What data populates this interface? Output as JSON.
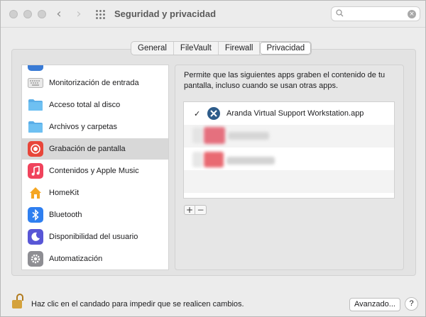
{
  "window": {
    "title": "Seguridad y privacidad",
    "search": {
      "placeholder": "",
      "value": ""
    }
  },
  "tabs": [
    {
      "label": "General"
    },
    {
      "label": "FileVault"
    },
    {
      "label": "Firewall"
    },
    {
      "label": "Privacidad",
      "active": true
    }
  ],
  "sidebar": {
    "items": [
      {
        "label": "Monitorización de entrada",
        "icon": "keyboard-icon"
      },
      {
        "label": "Acceso total al disco",
        "icon": "folder-icon"
      },
      {
        "label": "Archivos y carpetas",
        "icon": "folder-icon"
      },
      {
        "label": "Grabación de pantalla",
        "icon": "screen-recording-icon",
        "selected": true
      },
      {
        "label": "Contenidos y Apple Music",
        "icon": "music-icon"
      },
      {
        "label": "HomeKit",
        "icon": "home-icon"
      },
      {
        "label": "Bluetooth",
        "icon": "bluetooth-icon"
      },
      {
        "label": "Disponibilidad del usuario",
        "icon": "moon-icon"
      },
      {
        "label": "Automatización",
        "icon": "gear-icon"
      }
    ]
  },
  "panel": {
    "description": "Permite que las siguientes apps graben el contenido de tu pantalla, incluso cuando se usan otras apps.",
    "apps": [
      {
        "name": "Aranda Virtual Support Workstation.app",
        "checked": true,
        "checkmark": "✓"
      }
    ],
    "add_label": "+",
    "remove_label": "−"
  },
  "footer": {
    "lock_text": "Haz clic en el candado para impedir que se realicen cambios.",
    "advanced_label": "Avanzado...",
    "help_label": "?"
  }
}
